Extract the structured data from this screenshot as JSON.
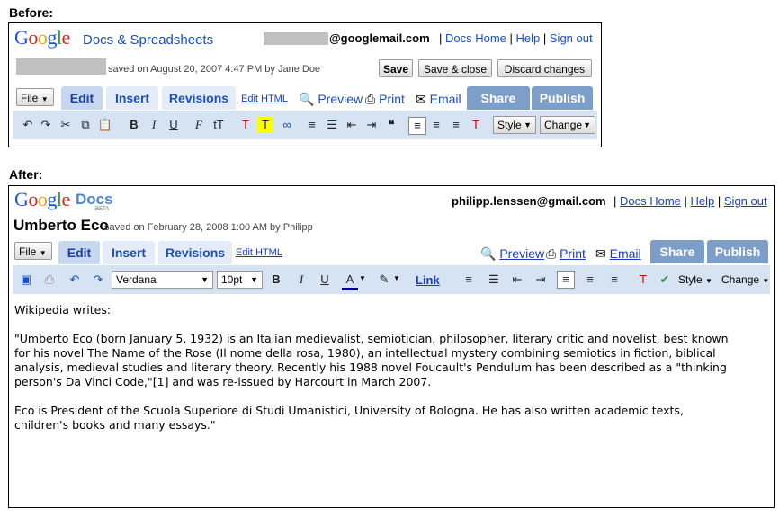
{
  "labels": {
    "before": "Before:",
    "after": "After:"
  },
  "before": {
    "logo": {
      "letters": [
        "G",
        "o",
        "o",
        "g",
        "l",
        "e"
      ],
      "product": "Docs & Spreadsheets"
    },
    "email": "@googlemail.com",
    "links": [
      "Docs Home",
      "Help",
      "Sign out"
    ],
    "saved_text": "saved on August 20, 2007 4:47 PM by Jane Doe",
    "buttons": {
      "save": "Save",
      "save_close": "Save & close",
      "discard": "Discard changes"
    },
    "tabs": {
      "file": "File",
      "edit": "Edit",
      "insert": "Insert",
      "revisions": "Revisions",
      "edit_html": "Edit HTML"
    },
    "actions": {
      "preview": "Preview",
      "print": "Print",
      "email": "Email",
      "share": "Share",
      "publish": "Publish"
    },
    "toolbar": {
      "style": "Style",
      "change": "Change"
    }
  },
  "after": {
    "logo": {
      "letters": [
        "G",
        "o",
        "o",
        "g",
        "l",
        "e"
      ],
      "product": "Docs",
      "beta": "BETA"
    },
    "email": "philipp.lenssen@gmail.com",
    "links": [
      "Docs Home",
      "Help",
      "Sign out"
    ],
    "doc_title": "Umberto Eco",
    "saved_text": "saved on February 28, 2008 1:00 AM by Philipp",
    "tabs": {
      "file": "File",
      "edit": "Edit",
      "insert": "Insert",
      "revisions": "Revisions",
      "edit_html": "Edit HTML"
    },
    "actions": {
      "preview": "Preview",
      "print": "Print",
      "email": "Email",
      "share": "Share",
      "publish": "Publish"
    },
    "toolbar": {
      "font": "Verdana",
      "size": "10pt",
      "link": "Link",
      "style": "Style",
      "change": "Change"
    },
    "document": {
      "p1": "Wikipedia writes:",
      "p2_lines": [
        "\"Umberto Eco (born January 5, 1932) is an Italian medievalist, semiotician, philosopher, literary critic and novelist, best known",
        "for his novel The Name of the Rose (Il nome della rosa, 1980), an intellectual mystery combining semiotics in fiction, biblical",
        "analysis, medieval studies and literary theory. Recently his 1988 novel Foucault's Pendulum has been described as a \"thinking",
        "person's Da Vinci Code,\"[1] and was re-issued by Harcourt in March 2007."
      ],
      "p3_lines": [
        "Eco is President of the Scuola Superiore di Studi Umanistici, University of Bologna. He has also written academic texts,",
        "children's books and many essays.\""
      ]
    }
  }
}
